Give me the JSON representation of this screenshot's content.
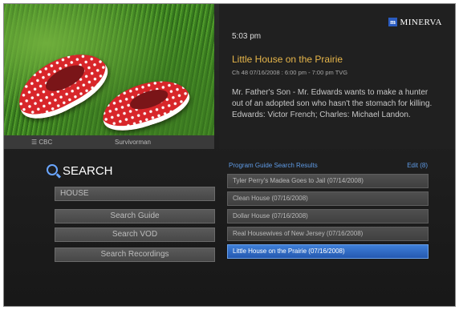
{
  "preview": {
    "channel": "☰ CBC",
    "show": "Survivorman"
  },
  "header": {
    "brand": "MINERVA",
    "brand_mark": "m",
    "time": "5:03 pm"
  },
  "program": {
    "title": "Little House on the Prairie",
    "meta": "Ch 48 07/16/2008 : 6:00 pm - 7:00 pm TVG",
    "description": "Mr. Father's Son - Mr. Edwards wants to make a hunter out of an adopted son who hasn't the stomach for killing. Edwards: Victor French; Charles: Michael Landon."
  },
  "search": {
    "heading": "SEARCH",
    "query": "HOUSE",
    "buttons": [
      "Search Guide",
      "Search VOD",
      "Search Recordings"
    ]
  },
  "results": {
    "heading": "Program Guide Search Results",
    "edit_label": "Edit (8)",
    "items": [
      "Tyler Perry's Madea Goes to Jail (07/14/2008)",
      "Clean House (07/16/2008)",
      "Dollar House (07/16/2008)",
      "Real Housewives of New Jersey (07/16/2008)",
      "Little House on the Prairie (07/16/2008)"
    ],
    "selected_index": 4
  },
  "colors": {
    "accent": "#e7b64a",
    "highlight": "#3e7fd8",
    "link": "#5f9be6"
  }
}
